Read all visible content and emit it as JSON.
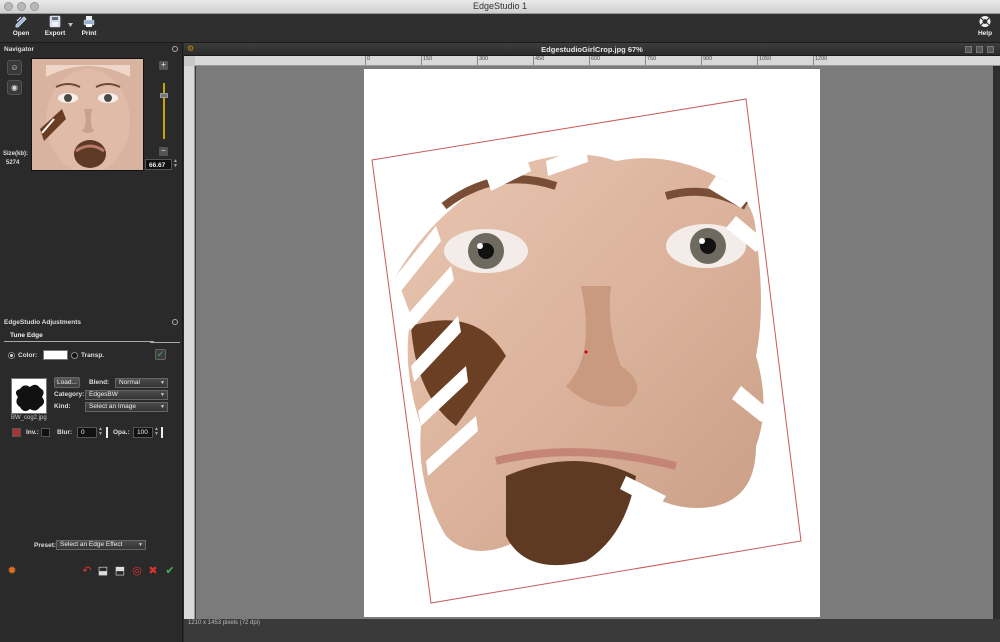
{
  "window": {
    "title": "EdgeStudio 1"
  },
  "toolbar": {
    "open_label": "Open",
    "export_label": "Export",
    "print_label": "Print",
    "help_label": "Help"
  },
  "navigator": {
    "title": "Navigator",
    "size_label": "Size(kb):",
    "size_value": "5274",
    "zoom_value": "66.67"
  },
  "adjustments": {
    "title": "EdgeStudio Adjustments",
    "tab_label": "Tune Edge",
    "color_label": "Color:",
    "transp_label": "Transp.",
    "color_value": "#ffffff",
    "transparent_checked": true,
    "load_label": "Load...",
    "blend_label": "Blend:",
    "blend_value": "Normal",
    "category_label": "Category:",
    "category_value": "EdgesBW",
    "kind_label": "Kind:",
    "kind_value": "Select an Image",
    "edge_file": "BW_cog2.jpg",
    "inv_label": "Inv.:",
    "blur_label": "Blur:",
    "blur_value": "0",
    "opa_label": "Opa.:",
    "opa_value": "100",
    "preset_label": "Preset:",
    "preset_value": "Select an Edge Effect"
  },
  "document": {
    "title": "EdgestudioGirlCrop.jpg 67%",
    "status": "1210 x 1453 pixels (72 dpi)",
    "ruler_labels": [
      "0",
      "150",
      "300",
      "450",
      "600",
      "750",
      "900",
      "1050",
      "1200"
    ]
  },
  "colors": {
    "accent_yellow": "#c8a400",
    "check_green": "#4caf50",
    "crop_red": "#c85a5a"
  }
}
